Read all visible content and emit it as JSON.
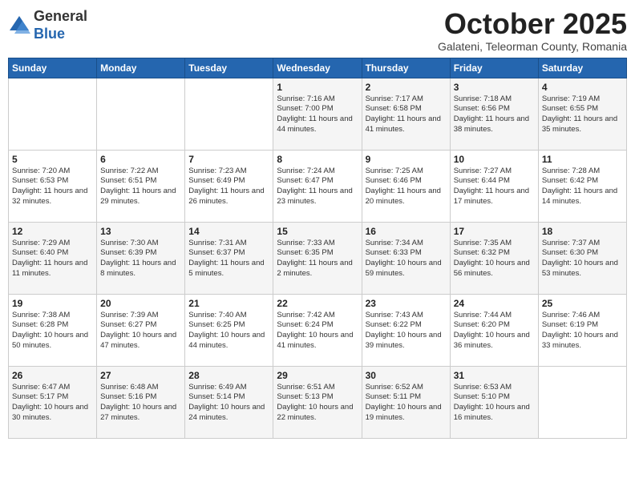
{
  "header": {
    "logo_general": "General",
    "logo_blue": "Blue",
    "month_title": "October 2025",
    "subtitle": "Galateni, Teleorman County, Romania"
  },
  "weekdays": [
    "Sunday",
    "Monday",
    "Tuesday",
    "Wednesday",
    "Thursday",
    "Friday",
    "Saturday"
  ],
  "weeks": [
    [
      {
        "day": "",
        "content": ""
      },
      {
        "day": "",
        "content": ""
      },
      {
        "day": "",
        "content": ""
      },
      {
        "day": "1",
        "content": "Sunrise: 7:16 AM\nSunset: 7:00 PM\nDaylight: 11 hours and 44 minutes."
      },
      {
        "day": "2",
        "content": "Sunrise: 7:17 AM\nSunset: 6:58 PM\nDaylight: 11 hours and 41 minutes."
      },
      {
        "day": "3",
        "content": "Sunrise: 7:18 AM\nSunset: 6:56 PM\nDaylight: 11 hours and 38 minutes."
      },
      {
        "day": "4",
        "content": "Sunrise: 7:19 AM\nSunset: 6:55 PM\nDaylight: 11 hours and 35 minutes."
      }
    ],
    [
      {
        "day": "5",
        "content": "Sunrise: 7:20 AM\nSunset: 6:53 PM\nDaylight: 11 hours and 32 minutes."
      },
      {
        "day": "6",
        "content": "Sunrise: 7:22 AM\nSunset: 6:51 PM\nDaylight: 11 hours and 29 minutes."
      },
      {
        "day": "7",
        "content": "Sunrise: 7:23 AM\nSunset: 6:49 PM\nDaylight: 11 hours and 26 minutes."
      },
      {
        "day": "8",
        "content": "Sunrise: 7:24 AM\nSunset: 6:47 PM\nDaylight: 11 hours and 23 minutes."
      },
      {
        "day": "9",
        "content": "Sunrise: 7:25 AM\nSunset: 6:46 PM\nDaylight: 11 hours and 20 minutes."
      },
      {
        "day": "10",
        "content": "Sunrise: 7:27 AM\nSunset: 6:44 PM\nDaylight: 11 hours and 17 minutes."
      },
      {
        "day": "11",
        "content": "Sunrise: 7:28 AM\nSunset: 6:42 PM\nDaylight: 11 hours and 14 minutes."
      }
    ],
    [
      {
        "day": "12",
        "content": "Sunrise: 7:29 AM\nSunset: 6:40 PM\nDaylight: 11 hours and 11 minutes."
      },
      {
        "day": "13",
        "content": "Sunrise: 7:30 AM\nSunset: 6:39 PM\nDaylight: 11 hours and 8 minutes."
      },
      {
        "day": "14",
        "content": "Sunrise: 7:31 AM\nSunset: 6:37 PM\nDaylight: 11 hours and 5 minutes."
      },
      {
        "day": "15",
        "content": "Sunrise: 7:33 AM\nSunset: 6:35 PM\nDaylight: 11 hours and 2 minutes."
      },
      {
        "day": "16",
        "content": "Sunrise: 7:34 AM\nSunset: 6:33 PM\nDaylight: 10 hours and 59 minutes."
      },
      {
        "day": "17",
        "content": "Sunrise: 7:35 AM\nSunset: 6:32 PM\nDaylight: 10 hours and 56 minutes."
      },
      {
        "day": "18",
        "content": "Sunrise: 7:37 AM\nSunset: 6:30 PM\nDaylight: 10 hours and 53 minutes."
      }
    ],
    [
      {
        "day": "19",
        "content": "Sunrise: 7:38 AM\nSunset: 6:28 PM\nDaylight: 10 hours and 50 minutes."
      },
      {
        "day": "20",
        "content": "Sunrise: 7:39 AM\nSunset: 6:27 PM\nDaylight: 10 hours and 47 minutes."
      },
      {
        "day": "21",
        "content": "Sunrise: 7:40 AM\nSunset: 6:25 PM\nDaylight: 10 hours and 44 minutes."
      },
      {
        "day": "22",
        "content": "Sunrise: 7:42 AM\nSunset: 6:24 PM\nDaylight: 10 hours and 41 minutes."
      },
      {
        "day": "23",
        "content": "Sunrise: 7:43 AM\nSunset: 6:22 PM\nDaylight: 10 hours and 39 minutes."
      },
      {
        "day": "24",
        "content": "Sunrise: 7:44 AM\nSunset: 6:20 PM\nDaylight: 10 hours and 36 minutes."
      },
      {
        "day": "25",
        "content": "Sunrise: 7:46 AM\nSunset: 6:19 PM\nDaylight: 10 hours and 33 minutes."
      }
    ],
    [
      {
        "day": "26",
        "content": "Sunrise: 6:47 AM\nSunset: 5:17 PM\nDaylight: 10 hours and 30 minutes."
      },
      {
        "day": "27",
        "content": "Sunrise: 6:48 AM\nSunset: 5:16 PM\nDaylight: 10 hours and 27 minutes."
      },
      {
        "day": "28",
        "content": "Sunrise: 6:49 AM\nSunset: 5:14 PM\nDaylight: 10 hours and 24 minutes."
      },
      {
        "day": "29",
        "content": "Sunrise: 6:51 AM\nSunset: 5:13 PM\nDaylight: 10 hours and 22 minutes."
      },
      {
        "day": "30",
        "content": "Sunrise: 6:52 AM\nSunset: 5:11 PM\nDaylight: 10 hours and 19 minutes."
      },
      {
        "day": "31",
        "content": "Sunrise: 6:53 AM\nSunset: 5:10 PM\nDaylight: 10 hours and 16 minutes."
      },
      {
        "day": "",
        "content": ""
      }
    ]
  ]
}
